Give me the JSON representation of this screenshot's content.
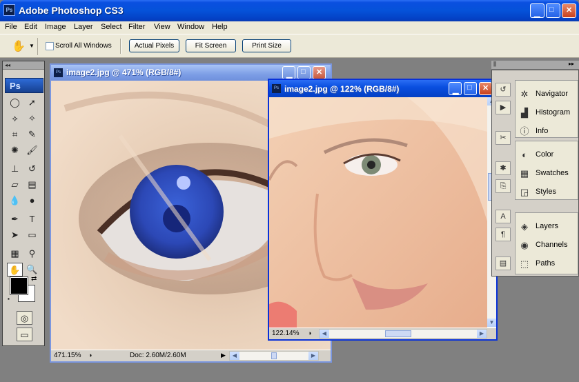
{
  "app": {
    "icon": "Ps",
    "title": "Adobe Photoshop CS3"
  },
  "menu": [
    "File",
    "Edit",
    "Image",
    "Layer",
    "Select",
    "Filter",
    "View",
    "Window",
    "Help"
  ],
  "options": {
    "scroll_all_windows": "Scroll All Windows",
    "actual_pixels": "Actual Pixels",
    "fit_screen": "Fit Screen",
    "print_size": "Print Size"
  },
  "toolbox": {
    "logo": "Ps",
    "tools": [
      {
        "name": "marquee",
        "glyph": "◯"
      },
      {
        "name": "move",
        "glyph": "➚"
      },
      {
        "name": "lasso",
        "glyph": "⟡"
      },
      {
        "name": "magic-wand",
        "glyph": "✧"
      },
      {
        "name": "crop",
        "glyph": "⌗"
      },
      {
        "name": "slice",
        "glyph": "✎"
      },
      {
        "name": "healing",
        "glyph": "✺"
      },
      {
        "name": "brush",
        "glyph": "🖌"
      },
      {
        "name": "stamp",
        "glyph": "⊥"
      },
      {
        "name": "history-brush",
        "glyph": "↺"
      },
      {
        "name": "eraser",
        "glyph": "▱"
      },
      {
        "name": "gradient",
        "glyph": "▤"
      },
      {
        "name": "blur",
        "glyph": "💧"
      },
      {
        "name": "dodge",
        "glyph": "●"
      },
      {
        "name": "pen",
        "glyph": "✒"
      },
      {
        "name": "type",
        "glyph": "T"
      },
      {
        "name": "path-select",
        "glyph": "➤"
      },
      {
        "name": "shape",
        "glyph": "▭"
      },
      {
        "name": "notes",
        "glyph": "▦"
      },
      {
        "name": "eyedropper",
        "glyph": "⚲"
      },
      {
        "name": "hand",
        "glyph": "✋"
      },
      {
        "name": "zoom",
        "glyph": "🔍"
      }
    ],
    "colors": {
      "foreground": "#000000",
      "background": "#ffffff"
    }
  },
  "doc1": {
    "title": "image2.jpg @ 471% (RGB/8#)",
    "zoom": "471.15%",
    "doc_info": "Doc: 2.60M/2.60M"
  },
  "doc2": {
    "title": "image2.jpg @ 122% (RGB/8#)",
    "zoom": "122.14%"
  },
  "panels": {
    "group1": [
      {
        "label": "Navigator",
        "icon": "navigator-icon",
        "glyph": "✲"
      },
      {
        "label": "Histogram",
        "icon": "histogram-icon",
        "glyph": "▟"
      },
      {
        "label": "Info",
        "icon": "info-icon",
        "glyph": "ⓘ"
      }
    ],
    "group2": [
      {
        "label": "Color",
        "icon": "color-icon",
        "glyph": "◐"
      },
      {
        "label": "Swatches",
        "icon": "swatches-icon",
        "glyph": "▦"
      },
      {
        "label": "Styles",
        "icon": "styles-icon",
        "glyph": "◲"
      }
    ],
    "group3": [
      {
        "label": "Layers",
        "icon": "layers-icon",
        "glyph": "◈"
      },
      {
        "label": "Channels",
        "icon": "channels-icon",
        "glyph": "◉"
      },
      {
        "label": "Paths",
        "icon": "paths-icon",
        "glyph": "⬚"
      }
    ]
  }
}
